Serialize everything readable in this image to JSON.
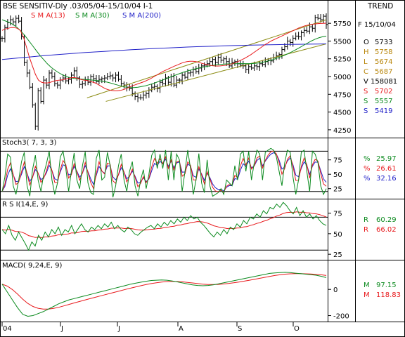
{
  "header": {
    "title": "BSE SENSITIV-Dly .03/05/04-15/10/04  I-1",
    "trend_label": "TREND",
    "date_label": "F 15/10/04"
  },
  "colors": {
    "price": "#000000",
    "sma13": "#e8191c",
    "sma30": "#0b8a1e",
    "sma200": "#2020c8",
    "channel": "#8c8c14",
    "guide": "#000000",
    "stoch_k": "#0b8a1e",
    "stoch_d1": "#e8191c",
    "stoch_d2": "#2020c8",
    "rsi": "#0b8a1e",
    "rsi_avg": "#e8191c",
    "macd": "#0b8a1e",
    "macd_signal": "#e8191c"
  },
  "chart_data": [
    {
      "type": "ohlc",
      "title": "BSE SENSITIV-Dly .03/05/04-15/10/04  I-1",
      "legend": [
        "S M A(13)",
        "S M A(30)",
        "S M A(200)"
      ],
      "ylim": [
        4150,
        5900
      ],
      "yticks": [
        4250,
        4500,
        4750,
        5000,
        5250,
        5500,
        5750
      ],
      "x_labels": [
        "04",
        "J",
        "J",
        "A",
        "S",
        "O"
      ],
      "bars_count": 118,
      "close": [
        5540,
        5690,
        5760,
        5800,
        5770,
        5820,
        5780,
        5560,
        5200,
        5050,
        4850,
        4600,
        4300,
        4800,
        4650,
        4950,
        4880,
        5050,
        5000,
        4900,
        4880,
        4950,
        4980,
        4940,
        4960,
        5020,
        5080,
        4980,
        4890,
        4900,
        4950,
        4920,
        5000,
        4970,
        4930,
        4960,
        4970,
        4980,
        5000,
        5010,
        4980,
        5020,
        4960,
        4900,
        4880,
        4850,
        4830,
        4760,
        4720,
        4700,
        4700,
        4740,
        4760,
        4810,
        4850,
        4860,
        4830,
        4920,
        4900,
        4980,
        4920,
        5000,
        4880,
        4950,
        4950,
        5020,
        4990,
        5050,
        5060,
        5100,
        5070,
        5120,
        5150,
        5160,
        5180,
        5210,
        5240,
        5200,
        5270,
        5230,
        5250,
        5210,
        5150,
        5200,
        5210,
        5180,
        5160,
        5150,
        5100,
        5140,
        5120,
        5150,
        5140,
        5180,
        5170,
        5210,
        5230,
        5220,
        5270,
        5290,
        5310,
        5380,
        5420,
        5500,
        5480,
        5540,
        5570,
        5560,
        5620,
        5650,
        5640,
        5700,
        5680,
        5830,
        5820,
        5800,
        5850,
        5733
      ],
      "sma13": [
        5650,
        5670,
        5680,
        5690,
        5690,
        5680,
        5650,
        5560,
        5420,
        5270,
        5150,
        5030,
        4950,
        4920,
        4910,
        4910,
        4920,
        4935,
        4945,
        4950,
        4955,
        4965,
        4975,
        4985,
        4985,
        4975,
        4960,
        4950,
        4945,
        4935,
        4920,
        4905,
        4880,
        4855,
        4830,
        4815,
        4805,
        4800,
        4800,
        4805,
        4815,
        4830,
        4850,
        4870,
        4885,
        4900,
        4915,
        4930,
        4950,
        4970,
        4995,
        5020,
        5045,
        5070,
        5090,
        5110,
        5130,
        5150,
        5165,
        5185,
        5200,
        5210,
        5215,
        5215,
        5210,
        5200,
        5185,
        5175,
        5165,
        5155,
        5150,
        5148,
        5150,
        5155,
        5160,
        5170,
        5180,
        5195,
        5215,
        5235,
        5255,
        5280,
        5305,
        5335,
        5365,
        5395,
        5425,
        5455,
        5480,
        5505,
        5525,
        5545,
        5565,
        5585,
        5605,
        5625,
        5645,
        5665,
        5685,
        5700,
        5715,
        5725,
        5735,
        5740,
        5745,
        5748,
        5750,
        5752
      ],
      "sma30": [
        5800,
        5780,
        5760,
        5730,
        5690,
        5640,
        5580,
        5510,
        5440,
        5370,
        5300,
        5240,
        5180,
        5130,
        5090,
        5055,
        5025,
        5000,
        4985,
        4975,
        4970,
        4965,
        4960,
        4955,
        4950,
        4945,
        4940,
        4930,
        4920,
        4905,
        4890,
        4875,
        4860,
        4850,
        4845,
        4845,
        4850,
        4860,
        4870,
        4885,
        4900,
        4920,
        4940,
        4960,
        4980,
        5000,
        5020,
        5040,
        5060,
        5075,
        5090,
        5105,
        5118,
        5130,
        5140,
        5150,
        5158,
        5165,
        5170,
        5175,
        5178,
        5180,
        5181,
        5182,
        5182,
        5182,
        5182,
        5185,
        5190,
        5200,
        5212,
        5226,
        5242,
        5260,
        5280,
        5302,
        5326,
        5352,
        5380,
        5410,
        5440,
        5470,
        5500,
        5525,
        5545,
        5560,
        5570
      ],
      "sma200": [
        5240,
        5252,
        5264,
        5276,
        5288,
        5300,
        5310,
        5320,
        5330,
        5338,
        5346,
        5354,
        5362,
        5370,
        5378,
        5385,
        5392,
        5398,
        5404,
        5410,
        5416,
        5420,
        5424,
        5428,
        5432,
        5436,
        5439,
        5442,
        5445,
        5448,
        5450,
        5452,
        5454,
        5456,
        5458,
        5460
      ],
      "channel_upper": [
        [
          4700,
          5020
        ],
        [
          5900,
          5800
        ]
      ],
      "channel_lower": [
        [
          4650,
          4630
        ],
        [
          5800,
          5460
        ]
      ]
    },
    {
      "type": "line",
      "title": "Stoch3( 7, 3, 3)",
      "ylim": [
        10,
        110
      ],
      "yticks": [
        25,
        50,
        75
      ],
      "guides": [
        20,
        90
      ],
      "series": [
        {
          "name": "%",
          "values": [
            20,
            45,
            85,
            80,
            30,
            15,
            40,
            72,
            88,
            30,
            12,
            58,
            83,
            40,
            20,
            50,
            68,
            90,
            40,
            15,
            35,
            80,
            90,
            60,
            20,
            55,
            87,
            40,
            25,
            65,
            89,
            35,
            18,
            15,
            78,
            92,
            40,
            45,
            88,
            65,
            10,
            30,
            65,
            85,
            40,
            20,
            55,
            72,
            30,
            12,
            40,
            58,
            25,
            50,
            83,
            92,
            60,
            85,
            60,
            92,
            40,
            90,
            40,
            85,
            75,
            20,
            55,
            92,
            60,
            15,
            40,
            86,
            35,
            18,
            75,
            30,
            12,
            15,
            18,
            25,
            15,
            40,
            35,
            30,
            65,
            40,
            85,
            90,
            55,
            90,
            40,
            70,
            92,
            85,
            40,
            88,
            92,
            95,
            92,
            80,
            55,
            30,
            70,
            92,
            88,
            45,
            15,
            40,
            88,
            92,
            55,
            20,
            90,
            85,
            70,
            30,
            15,
            25
          ]
        }
      ],
      "values_shown": [
        {
          "label": "%",
          "value": "25.97"
        },
        {
          "label": "%",
          "value": "26.61"
        },
        {
          "label": "%",
          "value": "32.16"
        }
      ]
    },
    {
      "type": "line",
      "title": "R S I(14,E, 9)",
      "ylim": [
        20,
        90
      ],
      "yticks": [
        25,
        50,
        75
      ],
      "guides": [
        30,
        70
      ],
      "series": [
        {
          "name": "R",
          "values": [
            55,
            50,
            60,
            48,
            42,
            52,
            45,
            38,
            30,
            40,
            35,
            48,
            42,
            52,
            46,
            55,
            50,
            58,
            48,
            55,
            52,
            60,
            50,
            56,
            62,
            55,
            52,
            58,
            55,
            60,
            56,
            62,
            58,
            64,
            56,
            60,
            55,
            52,
            58,
            55,
            50,
            48,
            52,
            55,
            58,
            60,
            56,
            62,
            58,
            64,
            60,
            66,
            62,
            68,
            64,
            70,
            66,
            72,
            68,
            70,
            64,
            60,
            55,
            50,
            46,
            52,
            48,
            55,
            50,
            58,
            55,
            62,
            58,
            66,
            62,
            70,
            68,
            74,
            70,
            78,
            74,
            82,
            80,
            86,
            82,
            88,
            84,
            78,
            74,
            82,
            72,
            78,
            70,
            74,
            68,
            72,
            66,
            62,
            60
          ]
        }
      ],
      "values_shown": [
        {
          "label": "R",
          "value": "60.29"
        },
        {
          "label": "R",
          "value": "66.02"
        }
      ]
    },
    {
      "type": "line",
      "title": "MACD( 9,24,E, 9)",
      "ylim": [
        -240,
        210
      ],
      "yticks": [
        0,
        -200
      ],
      "series": [
        {
          "name": "M",
          "values": [
            40,
            -20,
            -80,
            -140,
            -190,
            -205,
            -200,
            -185,
            -170,
            -150,
            -130,
            -110,
            -95,
            -80,
            -70,
            -60,
            -50,
            -40,
            -30,
            -20,
            -10,
            0,
            10,
            20,
            30,
            40,
            48,
            55,
            62,
            68,
            70,
            72,
            70,
            65,
            58,
            50,
            42,
            35,
            30,
            28,
            30,
            35,
            42,
            50,
            58,
            66,
            74,
            82,
            90,
            98,
            106,
            114,
            122,
            126,
            128,
            130,
            128,
            124,
            120,
            116,
            112,
            108,
            100,
            90
          ]
        }
      ],
      "values_shown": [
        {
          "label": "M",
          "value": "97.15"
        },
        {
          "label": "M",
          "value": "118.83"
        }
      ]
    }
  ],
  "info_panel": {
    "price_values": [
      {
        "label": "O",
        "value": "5733"
      },
      {
        "label": "H",
        "value": "5758"
      },
      {
        "label": "L",
        "value": "5674"
      },
      {
        "label": "C",
        "value": "5687"
      },
      {
        "label": "V",
        "value": "158081"
      },
      {
        "label": "S",
        "value": "5702"
      },
      {
        "label": "S",
        "value": "5557"
      },
      {
        "label": "S",
        "value": "5419"
      }
    ]
  }
}
